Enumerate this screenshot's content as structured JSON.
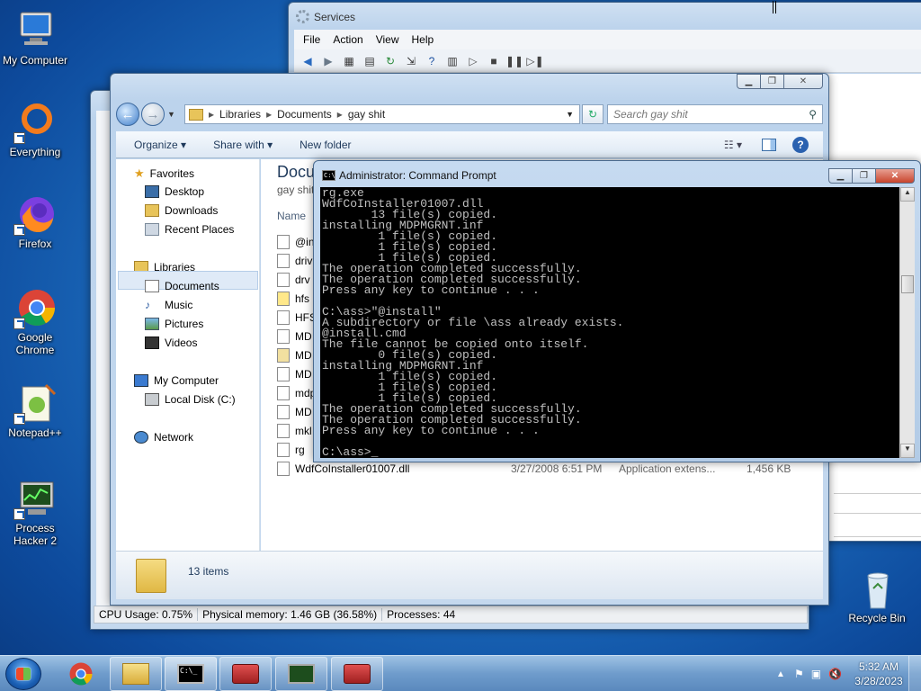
{
  "desktop": {
    "icons": [
      {
        "label": "My Computer"
      },
      {
        "label": "Everything"
      },
      {
        "label": "Firefox"
      },
      {
        "label": "Google Chrome"
      },
      {
        "label": "Notepad++"
      },
      {
        "label": "Process Hacker 2"
      },
      {
        "label": "Recycle Bin"
      }
    ]
  },
  "services": {
    "title": "Services",
    "menu": [
      "File",
      "Action",
      "View",
      "Help"
    ]
  },
  "explorer": {
    "breadcrumb": [
      "Libraries",
      "Documents",
      "gay shit"
    ],
    "search_placeholder": "Search gay shit",
    "commands": {
      "organize": "Organize",
      "share": "Share with",
      "new_folder": "New folder"
    },
    "nav": {
      "favorites": "Favorites",
      "desktop": "Desktop",
      "downloads": "Downloads",
      "recent": "Recent Places",
      "libraries": "Libraries",
      "documents": "Documents",
      "music": "Music",
      "pictures": "Pictures",
      "videos": "Videos",
      "computer": "My Computer",
      "local_disk": "Local Disk (C:)",
      "network": "Network"
    },
    "content_title": "Docu",
    "content_subtitle": "gay shit",
    "col_name": "Name",
    "files": [
      "@in",
      "driv",
      "drv",
      "hfs",
      "HFS",
      "MD",
      "MD",
      "MD",
      "mdp",
      "MD",
      "mkl",
      "rg"
    ],
    "last_file": {
      "name": "WdfCoInstaller01007.dll",
      "date": "3/27/2008 6:51 PM",
      "type": "Application extens...",
      "size": "1,456 KB"
    },
    "status_count": "13 items"
  },
  "process_hacker_status": {
    "cpu": "CPU Usage: 0.75%",
    "memory": "Physical memory: 1.46 GB (36.58%)",
    "processes": "Processes: 44"
  },
  "cmd": {
    "title": "Administrator: Command Prompt",
    "output": "rg.exe\nWdfCoInstaller01007.dll\n       13 file(s) copied.\ninstalling MDPMGRNT.inf\n        1 file(s) copied.\n        1 file(s) copied.\n        1 file(s) copied.\nThe operation completed successfully.\nThe operation completed successfully.\nPress any key to continue . . .\n\nC:\\ass>\"@install\"\nA subdirectory or file \\ass already exists.\n@install.cmd\nThe file cannot be copied onto itself.\n        0 file(s) copied.\ninstalling MDPMGRNT.inf\n        1 file(s) copied.\n        1 file(s) copied.\n        1 file(s) copied.\nThe operation completed successfully.\nThe operation completed successfully.\nPress any key to continue . . .\n\nC:\\ass>_"
  },
  "taskbar": {
    "time": "5:32 AM",
    "date": "3/28/2023"
  }
}
